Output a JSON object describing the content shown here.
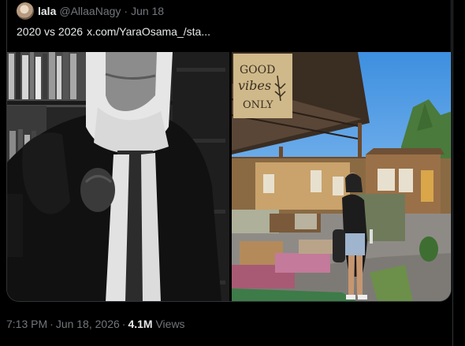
{
  "quoted_tweet": {
    "display_name": "lala",
    "handle": "@AllaaNagy",
    "separator": "·",
    "date": "Jun 18",
    "text": "2020 vs 2026",
    "link_text": "x.com/YaraOsama_/sta..."
  },
  "sign_text": {
    "line1": "GOOD",
    "line2": "vibes",
    "line3": "ONLY"
  },
  "footer": {
    "time": "7:13 PM",
    "separator1": "·",
    "date": "Jun 18, 2026",
    "separator2": "·",
    "views_count": "4.1M",
    "views_label": "Views"
  },
  "colors": {
    "background": "#000000",
    "primary_text": "#e7e9ea",
    "secondary_text": "#71767b",
    "border": "#2f3336"
  }
}
